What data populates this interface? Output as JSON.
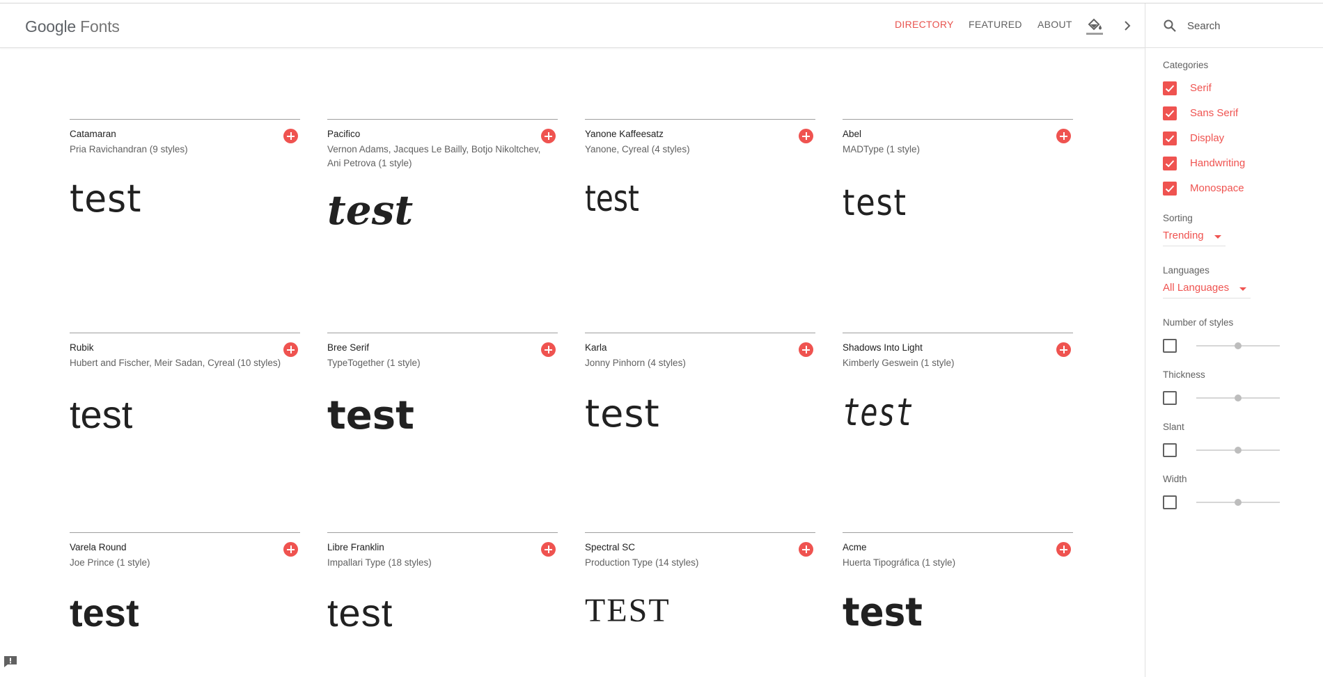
{
  "header": {
    "logo_google": "Google",
    "logo_fonts": "Fonts",
    "nav": [
      {
        "label": "DIRECTORY",
        "active": true
      },
      {
        "label": "FEATURED",
        "active": false
      },
      {
        "label": "ABOUT",
        "active": false
      }
    ],
    "icons": [
      "paint-bucket-icon",
      "chevron-right-icon"
    ]
  },
  "sidebar": {
    "search_placeholder": "Search",
    "categories_label": "Categories",
    "categories": [
      "Serif",
      "Sans Serif",
      "Display",
      "Handwriting",
      "Monospace"
    ],
    "sorting_label": "Sorting",
    "sorting_value": "Trending",
    "languages_label": "Languages",
    "languages_value": "All Languages",
    "filters": [
      "Number of styles",
      "Thickness",
      "Slant",
      "Width"
    ]
  },
  "sample_text": "test",
  "sample_text_caps": "TEST",
  "fonts": [
    {
      "name": "Catamaran",
      "designer": "Pria Ravichandran (9 styles)"
    },
    {
      "name": "Pacifico",
      "designer": "Vernon Adams, Jacques Le Bailly, Botjo Nikoltchev, Ani Petrova (1 style)"
    },
    {
      "name": "Yanone Kaffeesatz",
      "designer": "Yanone, Cyreal (4 styles)"
    },
    {
      "name": "Abel",
      "designer": "MADType (1 style)"
    },
    {
      "name": "Rubik",
      "designer": "Hubert and Fischer, Meir Sadan, Cyreal (10 styles)"
    },
    {
      "name": "Bree Serif",
      "designer": "TypeTogether (1 style)"
    },
    {
      "name": "Karla",
      "designer": "Jonny Pinhorn (4 styles)"
    },
    {
      "name": "Shadows Into Light",
      "designer": "Kimberly Geswein (1 style)"
    },
    {
      "name": "Varela Round",
      "designer": "Joe Prince (1 style)"
    },
    {
      "name": "Libre Franklin",
      "designer": "Impallari Type (18 styles)"
    },
    {
      "name": "Spectral SC",
      "designer": "Production Type (14 styles)"
    },
    {
      "name": "Acme",
      "designer": "Huerta Tipográfica (1 style)"
    }
  ],
  "colors": {
    "accent": "#ef5350",
    "text": "#212121",
    "muted": "#616161"
  }
}
